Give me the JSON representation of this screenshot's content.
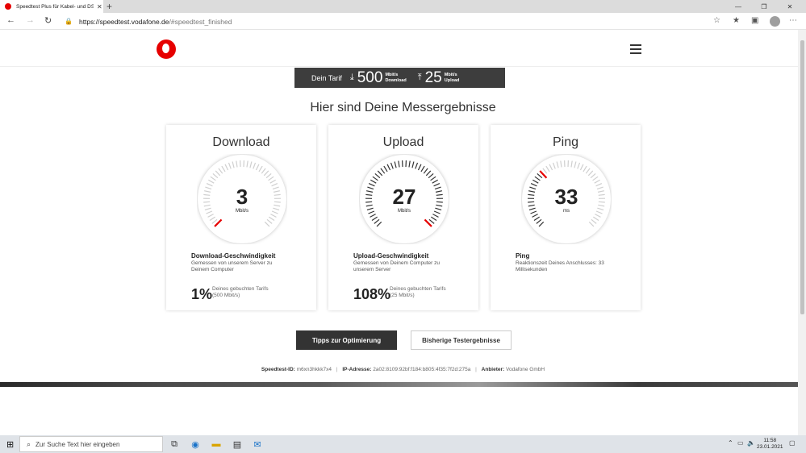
{
  "browser": {
    "tab_title": "Speedtest Plus für Kabel- und DSL",
    "url_host": "https://speedtest.vodafone.de",
    "url_path": "/#speedtest_finished"
  },
  "tariff": {
    "label": "Dein Tarif",
    "download_value": "500",
    "download_unit": "Mbit/s",
    "download_word": "Download",
    "upload_value": "25",
    "upload_unit": "Mbit/s",
    "upload_word": "Upload"
  },
  "headline": "Hier sind Deine Messergebnisse",
  "cards": [
    {
      "title": "Download",
      "value": "3",
      "unit": "Mbit/s",
      "fraction": 0.006,
      "metric_title": "Download-Geschwindigkeit",
      "metric_desc": "Gemessen von unserem Server zu Deinem Computer",
      "percent": "1%",
      "percent_desc_1": "Deines gebuchten Tarifs",
      "percent_desc_2": "(500 Mbit/s)"
    },
    {
      "title": "Upload",
      "value": "27",
      "unit": "Mbit/s",
      "fraction": 1.0,
      "metric_title": "Upload-Geschwindigkeit",
      "metric_desc": "Gemessen von Deinem Computer zu unserem Server",
      "percent": "108%",
      "percent_desc_1": "Deines gebuchten Tarifs",
      "percent_desc_2": "(25 Mbit/s)"
    },
    {
      "title": "Ping",
      "value": "33",
      "unit": "ms",
      "fraction": 0.33,
      "metric_title": "Ping",
      "metric_desc": "Reaktionszeit Deines Anschlusses: 33 Millisekunden"
    }
  ],
  "buttons": {
    "tips": "Tipps zur Optimierung",
    "history": "Bisherige Testergebnisse"
  },
  "meta": {
    "id_label": "Speedtest-ID:",
    "id_value": "m6xn3hkkk7x4",
    "ip_label": "IP-Adresse:",
    "ip_value": "2a02:8109:92bf:f184:b805:4f35:7f2d:275a",
    "provider_label": "Anbieter:",
    "provider_value": "Vodafone GmbH"
  },
  "taskbar": {
    "search_placeholder": "Zur Suche Text hier eingeben",
    "time": "11:58",
    "date": "23.01.2021"
  },
  "colors": {
    "accent": "#e60000",
    "dark": "#333333"
  }
}
